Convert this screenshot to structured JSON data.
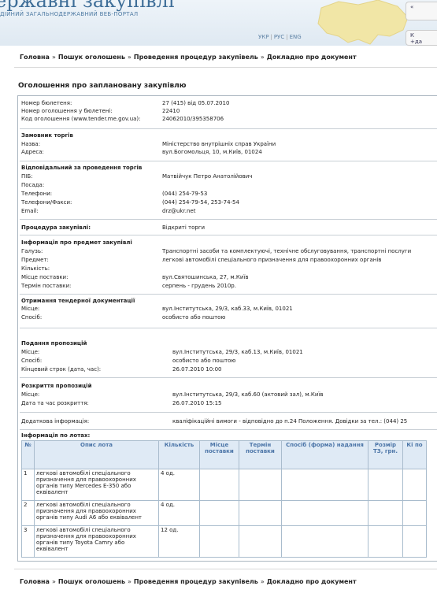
{
  "header": {
    "title": "ержавні закупівлі",
    "subtitle": "ДІЙНИЙ ЗАГАЛЬНОДЕРЖАВНИЙ ВЕБ-ПОРТАЛ",
    "languages": [
      "УКР",
      "РУС",
      "ENG"
    ],
    "side_button_1": "«",
    "side_button_2": "К\n+да"
  },
  "breadcrumb": [
    "Головна",
    "Пошук оголошень",
    "Проведення процедур закупівель",
    "Докладно про документ"
  ],
  "page_title": "Оголошення про заплановану закупівлю",
  "bulletin": {
    "rows": [
      {
        "label": "Номер бюлетеня:",
        "value": "27 (415) від 05.07.2010"
      },
      {
        "label": "Номер оголошення у бюлетені:",
        "value": "22410"
      },
      {
        "label": "Код оголошення (www.tender.me.gov.ua):",
        "value": "24062010/395358706"
      }
    ]
  },
  "customer": {
    "heading": "Замовник торгів",
    "name_label": "Назва:",
    "name": "Міністерство внутрішніх справ України",
    "address_label": "Адреса:",
    "address": "вул.Богомольця, 10, м.Київ, 01024"
  },
  "responsible": {
    "heading": "Відповідальний за проведення торгів",
    "rows": [
      {
        "label": "ПІБ:",
        "value": "Матвійчук Петро Анатолійович"
      },
      {
        "label": "Посада:",
        "value": ""
      },
      {
        "label": "Телефони:",
        "value": "(044) 254-79-53"
      },
      {
        "label": "Телефони/Факси:",
        "value": "(044) 254-79-54, 253-74-54"
      },
      {
        "label": "Email:",
        "value": "drz@ukr.net"
      }
    ]
  },
  "procedure": {
    "label": "Процедура закупівлі:",
    "value": "Відкриті торги"
  },
  "subject": {
    "heading": "Інформація про предмет закупівлі",
    "rows": [
      {
        "label": "Галузь:",
        "value": "Транспортні засоби та комплектуючі, технічне обслуговування, транспортні послуги"
      },
      {
        "label": "Предмет:",
        "value": "легкові автомобілі спеціального призначення для правоохоронних органів"
      },
      {
        "label": "Кількість:",
        "value": ""
      },
      {
        "label": "Місце поставки:",
        "value": "вул.Святошинська, 27, м.Київ"
      },
      {
        "label": "Термін поставки:",
        "value": "серпень - грудень 2010р."
      }
    ]
  },
  "docs": {
    "heading": "Отримання тендерної документації",
    "place_label": "Місце:",
    "place": "вул.Інститутська, 29/3, каб.33, м.Київ, 01021",
    "method_label": "Спосіб:",
    "method": "особисто або поштою"
  },
  "proposals": {
    "heading": "Подання пропозицій",
    "place_label": "Місце:",
    "place": "вул.Інститутська, 29/3, каб.13, м.Київ, 01021",
    "method_label": "Спосіб:",
    "method": "особисто або поштою",
    "deadline_label": "Кінцевий строк (дата, час):",
    "deadline": "26.07.2010 10:00"
  },
  "opening": {
    "heading": "Розкриття пропозицій",
    "place_label": "Місце:",
    "place": "вул.Інститутська, 29/3, каб.60 (актовий зал), м.Київ",
    "date_label": "Дата та час розкриття:",
    "date": "26.07.2010 15:15"
  },
  "additional": {
    "label": "Додаткова інформація:",
    "value": "кваліфікаційні вимоги - відповідно до п.24 Положення. Довідки за тел.: (044) 25"
  },
  "lots": {
    "heading": "Інформація по лотах:",
    "columns": [
      "№",
      "Опис лота",
      "Кількість",
      "Місце поставки",
      "Термін поставки",
      "Спосіб (форма) надання",
      "Розмір ТЗ, грн.",
      "Кі по"
    ],
    "rows": [
      {
        "num": "1",
        "desc": "легкові автомобілі спеціального призначення для правоохоронних органів типу Mercedes E-350 або еквівалент",
        "qty": "4 од."
      },
      {
        "num": "2",
        "desc": "легкові автомобілі спеціального призначення для правоохоронних органів типу Audi A6 або еквівалент",
        "qty": "4 од."
      },
      {
        "num": "3",
        "desc": "легкові автомобілі спеціального призначення для правоохоронних органів типу Toyota Camry або еквівалент",
        "qty": "12 од."
      }
    ]
  },
  "colors": {
    "accent": "#3e6e98",
    "table_header_bg": "#dfeaf5",
    "table_header_text": "#4d76a8"
  }
}
